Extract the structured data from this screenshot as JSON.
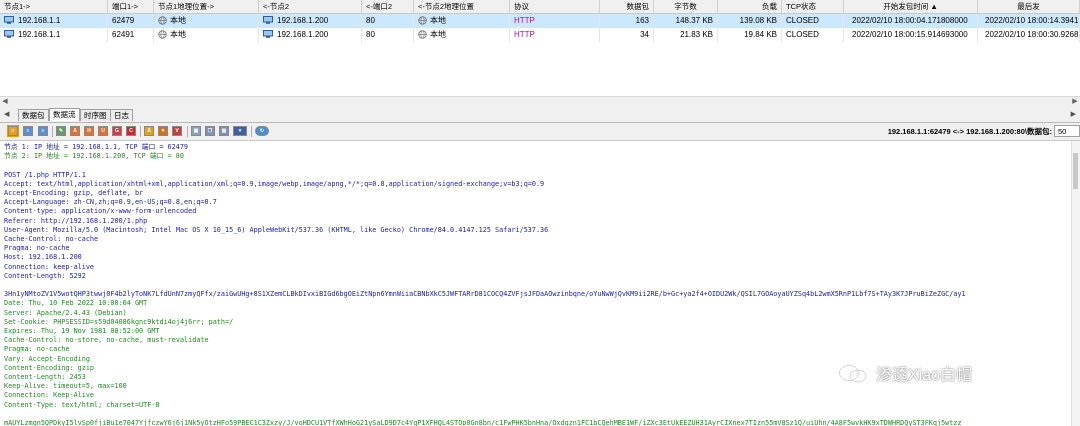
{
  "table": {
    "columns": [
      "节点1->",
      "端口1->",
      "节点1地理位置->",
      "<-节点2",
      "<-端口2",
      "<-节点2地理位置",
      "协议",
      "数据包",
      "字节数",
      "负载",
      "TCP状态",
      "开始发包时间 ▲",
      "最后发"
    ],
    "rows": [
      {
        "node1": "192.168.1.1",
        "port1": "62479",
        "geo1": "本地",
        "node2": "192.168.1.200",
        "port2": "80",
        "geo2": "本地",
        "protocol": "HTTP",
        "packets": "163",
        "bytes": "148.37 KB",
        "payload": "139.08 KB",
        "tcp_state": "CLOSED",
        "start_time": "2022/02/10 18:00:04.171808000",
        "last_time": "2022/02/10 18:00:14.3941"
      },
      {
        "node1": "192.168.1.1",
        "port1": "62491",
        "geo1": "本地",
        "node2": "192.168.1.200",
        "port2": "80",
        "geo2": "本地",
        "protocol": "HTTP",
        "packets": "34",
        "bytes": "21.83 KB",
        "payload": "19.84 KB",
        "tcp_state": "CLOSED",
        "start_time": "2022/02/10 18:00:15.914693000",
        "last_time": "2022/02/10 18:00:30.9268"
      }
    ]
  },
  "tabs": [
    "数据包",
    "数据流",
    "时序图",
    "日志"
  ],
  "toolbar": {
    "endpoint": "192.168.1.1:62479 <-> 192.168.1.200:80\\数据包:",
    "endpoint_value": "50"
  },
  "stream_lines": [
    {
      "text": "节点 1: IP 地址 = 192.168.1.1, TCP 端口 = 62479",
      "color": "blue"
    },
    {
      "text": "节点 2: IP 地址 = 192.168.1.200, TCP 端口 = 80",
      "color": "green"
    },
    {
      "text": "",
      "color": "blue"
    },
    {
      "text": "POST /1.php HTTP/1.1",
      "color": "blue"
    },
    {
      "text": "Accept: text/html,application/xhtml+xml,application/xml;q=0.9,image/webp,image/apng,*/*;q=0.8,application/signed-exchange;v=b3;q=0.9",
      "color": "blue"
    },
    {
      "text": "Accept-Encoding: gzip, deflate, br",
      "color": "blue"
    },
    {
      "text": "Accept-Language: zh-CN,zh;q=0.9,en-US;q=0.8,en;q=0.7",
      "color": "blue"
    },
    {
      "text": "Content-type: application/x-www-form-urlencoded",
      "color": "blue"
    },
    {
      "text": "Referer: http://192.168.1.200/1.php",
      "color": "blue"
    },
    {
      "text": "User-Agent: Mozilla/5.0 (Macintosh; Intel Mac OS X 10_15_6) AppleWebKit/537.36 (KHTML, like Gecko) Chrome/84.0.4147.125 Safari/537.36",
      "color": "blue"
    },
    {
      "text": "Cache-Control: no-cache",
      "color": "blue"
    },
    {
      "text": "Pragma: no-cache",
      "color": "blue"
    },
    {
      "text": "Host: 192.168.1.200",
      "color": "blue"
    },
    {
      "text": "Connection: keep-alive",
      "color": "blue"
    },
    {
      "text": "Content-Length: 5292",
      "color": "blue"
    },
    {
      "text": "",
      "color": "blue"
    },
    {
      "text": "3Hn1yNMtoZV1V5wotQHP3twwj0F4b2lyToNK7LfdUnN7zmyQFfx/zaiGwUHg+8S1XZemCLBkDIvxiBIGd6bgOEiZtNpn6YmnWiiaCBNbXkC5JWFTARrD81COCQ4ZVFjsJFDaAOwzinbqne/oYuNwWjQvKM9ii2RE/b+Gc+ya2f4+OIDU2Wk/QSIL7GOAoyaUYZSq4bL2wmX5RnP1Lbf7S+TAy3K7JPruBiZeZGC/ay1",
      "color": "blue"
    },
    {
      "text": "Date: Thu, 10 Feb 2022 10:00:04 GMT",
      "color": "green"
    },
    {
      "text": "Server: Apache/2.4.43 (Debian)",
      "color": "green"
    },
    {
      "text": "Set-Cookie: PHPSESSID=s59d04086kgnc9ktdi4oj4j6rr; path=/",
      "color": "green"
    },
    {
      "text": "Expires: Thu, 19 Nov 1981 08:52:00 GMT",
      "color": "green"
    },
    {
      "text": "Cache-Control: no-store, no-cache, must-revalidate",
      "color": "green"
    },
    {
      "text": "Pragma: no-cache",
      "color": "green"
    },
    {
      "text": "Vary: Accept-Encoding",
      "color": "green"
    },
    {
      "text": "Content-Encoding: gzip",
      "color": "green"
    },
    {
      "text": "Content-Length: 2453",
      "color": "green"
    },
    {
      "text": "Keep-Alive: timeout=5, max=100",
      "color": "green"
    },
    {
      "text": "Connection: Keep-Alive",
      "color": "green"
    },
    {
      "text": "Content-Type: text/html; charset=UTF-8",
      "color": "green"
    },
    {
      "text": "",
      "color": "green"
    },
    {
      "text": "mAUYLzmqn5QPDkyI5lvSp0fjiBu1e7047YjfczwY6j6j1Nk5yOtzHFo59PBEC1C3Zxzy/J/voHDCU1VTfXWhHoG21ySaLD9D7c4YqP1XFHQL4STOp0Gn8bn/c1FwPHK5bnHna/Oxdqzn1FC1bCQehMBE1WF/iZXc3EtUkEEZUH31AyrCIXnex7TIzn55mV8Sz1Q/uiUhn/4A8F5wvkHK9xTDWHRDQyST3FKqj5wtzz",
      "color": "green"
    }
  ],
  "watermark": "渗透Xiao白帽"
}
